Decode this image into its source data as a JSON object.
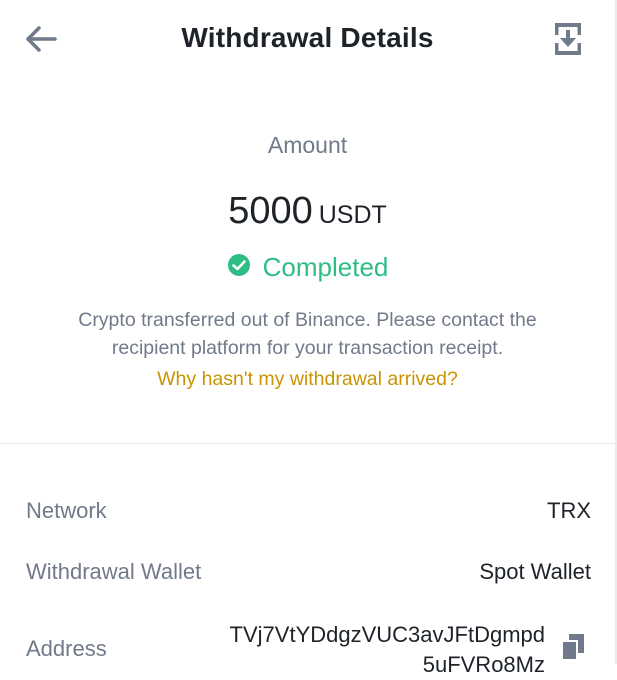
{
  "header": {
    "title": "Withdrawal Details"
  },
  "amount": {
    "label": "Amount",
    "value": "5000",
    "currency": "USDT"
  },
  "status": {
    "text": "Completed"
  },
  "note": "Crypto transferred out of Binance. Please contact the recipient platform for your transaction receipt.",
  "why_link": "Why hasn't my withdrawal arrived?",
  "details": {
    "network": {
      "label": "Network",
      "value": "TRX"
    },
    "wallet": {
      "label": "Withdrawal Wallet",
      "value": "Spot Wallet"
    },
    "address": {
      "label": "Address",
      "value_line1": "TVj7VtYDdgzVUC3avJFtDgmpd",
      "value_line2": "5uFVRo8Mz"
    }
  },
  "colors": {
    "completed": "#2ebd85",
    "link": "#c99400",
    "text": "#1e2329",
    "muted": "#707a8a"
  },
  "icons": {
    "back": "arrow-left-icon",
    "download": "download-icon",
    "status": "check-circle-icon",
    "copy": "copy-icon"
  }
}
